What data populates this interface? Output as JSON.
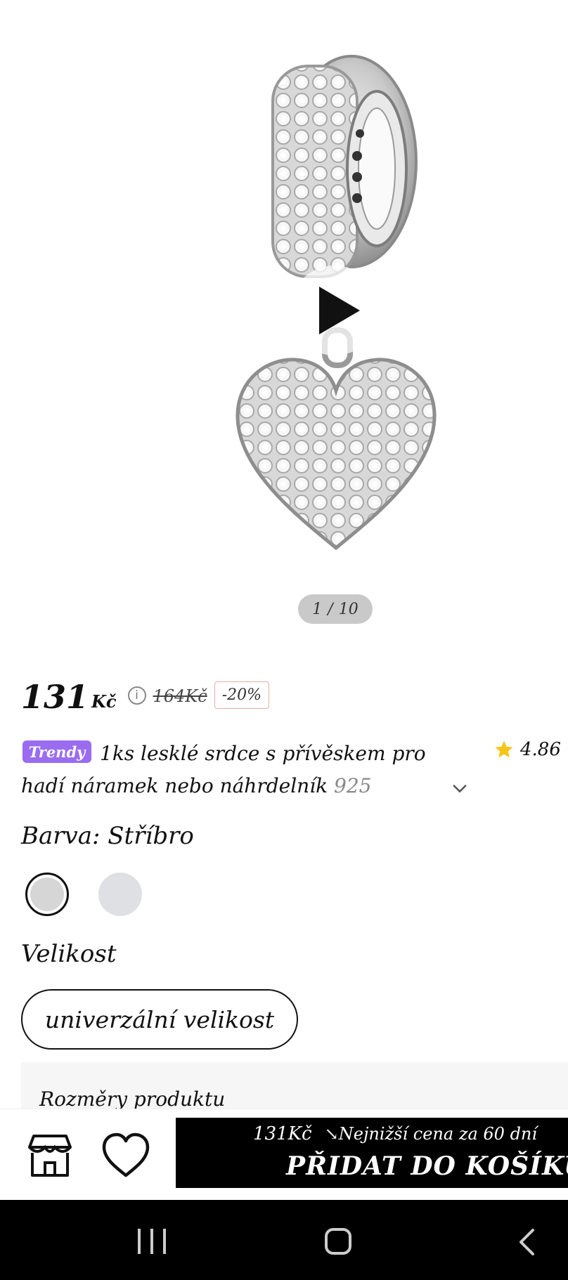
{
  "gallery": {
    "counter_current": "1",
    "counter_sep": "/",
    "counter_total": "10"
  },
  "price": {
    "current": "131",
    "currency": "Kč",
    "original": "164Kč",
    "discount": "-20%"
  },
  "product": {
    "badge": "Trendy",
    "title_main": "1ks lesklé srdce s přívěskem pro hadí náramek nebo náhrdelník",
    "title_tail": "925",
    "rating": "4.86"
  },
  "variants": {
    "color_label": "Barva: Stříbro",
    "size_label": "Velikost",
    "size_option": "univerzální velikost",
    "dimensions_label": "Rozměry produktu"
  },
  "cart": {
    "price": "131Kč",
    "lowest_note": "↘Nejnižší cena za 60 dní",
    "add_label": "PŘIDAT DO KOŠÍKU"
  },
  "colors": {
    "accent_trendy": "#9a6cf0",
    "star": "#f5c518",
    "cart_bg": "#000000"
  },
  "icons": [
    "play-icon",
    "info-icon",
    "star-icon",
    "chevron-down-icon",
    "store-icon",
    "heart-icon",
    "recent-apps-icon",
    "home-icon",
    "back-icon"
  ]
}
